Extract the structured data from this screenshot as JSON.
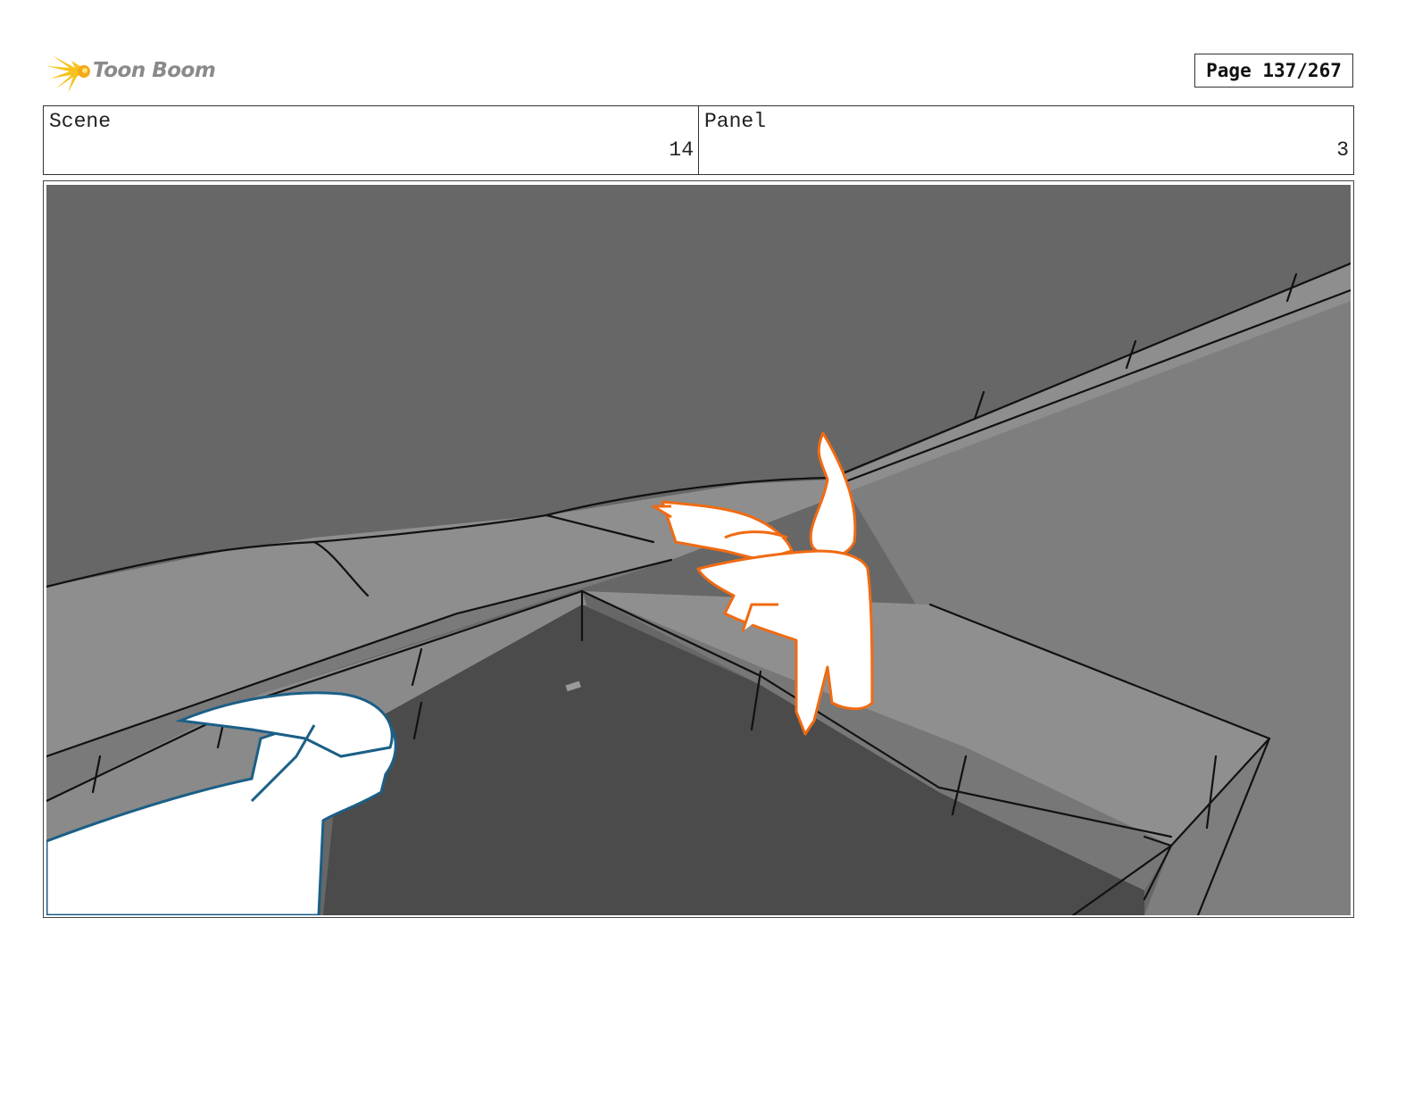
{
  "header": {
    "logo_text": "Toon Boom",
    "page_label": "Page 137/267"
  },
  "scene": {
    "label": "Scene",
    "value": "14"
  },
  "panel": {
    "label": "Panel",
    "value": "3"
  },
  "colors": {
    "wall": "#666666",
    "ledge": "#8f8f8f",
    "courtyard": "#4b4b4b",
    "foreground_outline": "#1b5f86",
    "character_outline": "#f06a12"
  }
}
